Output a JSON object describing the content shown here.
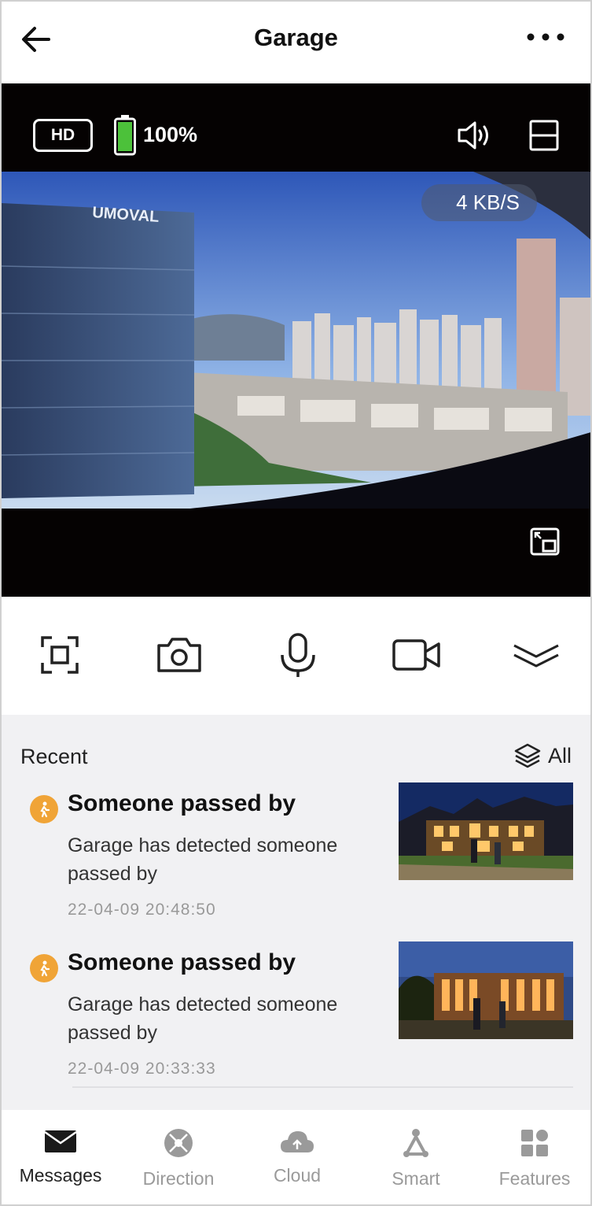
{
  "header": {
    "title": "Garage",
    "back_icon": "arrow-left-icon",
    "more_icon": "more-horizontal-icon"
  },
  "video": {
    "quality_label": "HD",
    "battery_percent": "100%",
    "battery_level": 1.0,
    "battery_color": "#4cc13a",
    "speed": "4 KB/S",
    "watermark_text": "UMOVAL",
    "volume_icon": "speaker-icon",
    "layout_icon": "split-view-icon",
    "pip_icon": "picture-in-picture-icon"
  },
  "controls": [
    {
      "icon": "screen-capture-icon"
    },
    {
      "icon": "camera-icon"
    },
    {
      "icon": "microphone-icon"
    },
    {
      "icon": "video-record-icon"
    },
    {
      "icon": "chevron-double-down-icon"
    }
  ],
  "recent": {
    "label": "Recent",
    "all_label": "All",
    "events": [
      {
        "title": "Someone passed by",
        "description": "Garage has detected someone passed by",
        "timestamp": "22-04-09 20:48:50",
        "badge_color": "#f0a437"
      },
      {
        "title": "Someone passed by",
        "description": "Garage has detected someone passed by",
        "timestamp": "22-04-09 20:33:33",
        "badge_color": "#f0a437"
      }
    ]
  },
  "nav": {
    "items": [
      {
        "label": "Messages",
        "icon": "envelope-icon",
        "active": true
      },
      {
        "label": "Direction",
        "icon": "direction-icon",
        "active": false
      },
      {
        "label": "Cloud",
        "icon": "cloud-icon",
        "active": false
      },
      {
        "label": "Smart",
        "icon": "smart-icon",
        "active": false
      },
      {
        "label": "Features",
        "icon": "features-grid-icon",
        "active": false
      }
    ]
  },
  "colors": {
    "accent": "#f0a437",
    "video_bg": "#050202",
    "recent_bg": "#f1f1f3",
    "nav_inactive": "#9a9a9a"
  }
}
